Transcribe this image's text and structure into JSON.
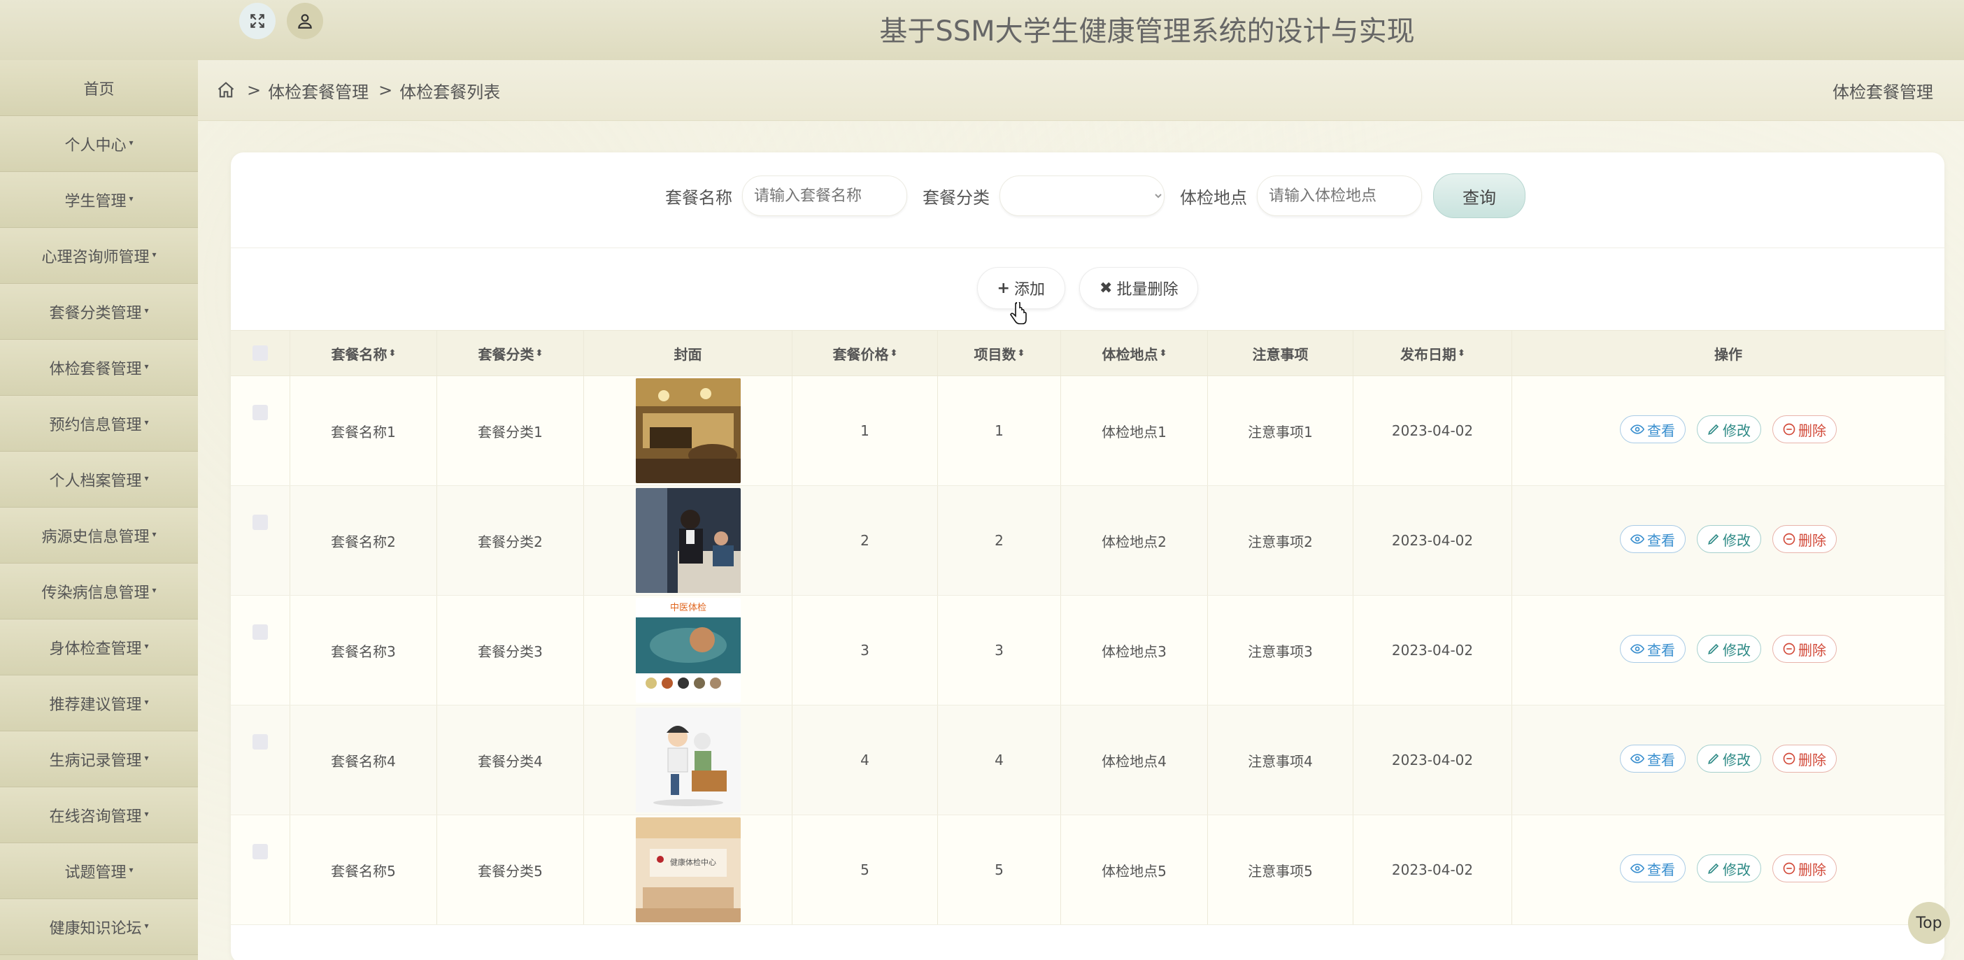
{
  "header": {
    "title": "基于SSM大学生健康管理系统的设计与实现"
  },
  "sidebar": {
    "items": [
      {
        "label": "首页",
        "has_caret": false
      },
      {
        "label": "个人中心",
        "has_caret": true
      },
      {
        "label": "学生管理",
        "has_caret": true
      },
      {
        "label": "心理咨询师管理",
        "has_caret": true
      },
      {
        "label": "套餐分类管理",
        "has_caret": true
      },
      {
        "label": "体检套餐管理",
        "has_caret": true
      },
      {
        "label": "预约信息管理",
        "has_caret": true
      },
      {
        "label": "个人档案管理",
        "has_caret": true
      },
      {
        "label": "病源史信息管理",
        "has_caret": true
      },
      {
        "label": "传染病信息管理",
        "has_caret": true
      },
      {
        "label": "身体检查管理",
        "has_caret": true
      },
      {
        "label": "推荐建议管理",
        "has_caret": true
      },
      {
        "label": "生病记录管理",
        "has_caret": true
      },
      {
        "label": "在线咨询管理",
        "has_caret": true
      },
      {
        "label": "试题管理",
        "has_caret": true
      },
      {
        "label": "健康知识论坛",
        "has_caret": true
      }
    ],
    "caret_glyph": "▾"
  },
  "breadcrumb": {
    "sep": ">",
    "level1": "体检套餐管理",
    "level2": "体检套餐列表",
    "right_title": "体检套餐管理"
  },
  "search": {
    "name_label": "套餐名称",
    "name_placeholder": "请输入套餐名称",
    "category_label": "套餐分类",
    "category_value": "",
    "location_label": "体检地点",
    "location_placeholder": "请输入体检地点",
    "query_label": "查询"
  },
  "actions": {
    "add_icon": "+",
    "add_label": "添加",
    "batch_delete_icon": "✖",
    "batch_delete_label": "批量删除"
  },
  "table": {
    "sort_glyph": "⬍",
    "headers": {
      "name": "套餐名称",
      "category": "套餐分类",
      "cover": "封面",
      "price": "套餐价格",
      "items": "项目数",
      "location": "体检地点",
      "notes": "注意事项",
      "date": "发布日期",
      "ops": "操作"
    },
    "rows": [
      {
        "name": "套餐名称1",
        "category": "套餐分类1",
        "price": "1",
        "items": "1",
        "location": "体检地点1",
        "notes": "注意事项1",
        "date": "2023-04-02"
      },
      {
        "name": "套餐名称2",
        "category": "套餐分类2",
        "price": "2",
        "items": "2",
        "location": "体检地点2",
        "notes": "注意事项2",
        "date": "2023-04-02"
      },
      {
        "name": "套餐名称3",
        "category": "套餐分类3",
        "price": "3",
        "items": "3",
        "location": "体检地点3",
        "notes": "注意事项3",
        "date": "2023-04-02"
      },
      {
        "name": "套餐名称4",
        "category": "套餐分类4",
        "price": "4",
        "items": "4",
        "location": "体检地点4",
        "notes": "注意事项4",
        "date": "2023-04-02"
      },
      {
        "name": "套餐名称5",
        "category": "套餐分类5",
        "price": "5",
        "items": "5",
        "location": "体检地点5",
        "notes": "注意事项5",
        "date": "2023-04-02"
      }
    ],
    "op_labels": {
      "view": "查看",
      "edit": "修改",
      "delete": "删除"
    },
    "cover_image_texts": {
      "row3": "中医体检",
      "row5": "健康体检中心"
    }
  },
  "back_to_top": "Top",
  "colors": {
    "header_bg": "#dedbbf",
    "sidebar_bg": "#dcd9b9",
    "page_bg": "#f8f7ec",
    "view": "#3a8fcf",
    "edit": "#2e8a86",
    "delete": "#d24a3a"
  }
}
